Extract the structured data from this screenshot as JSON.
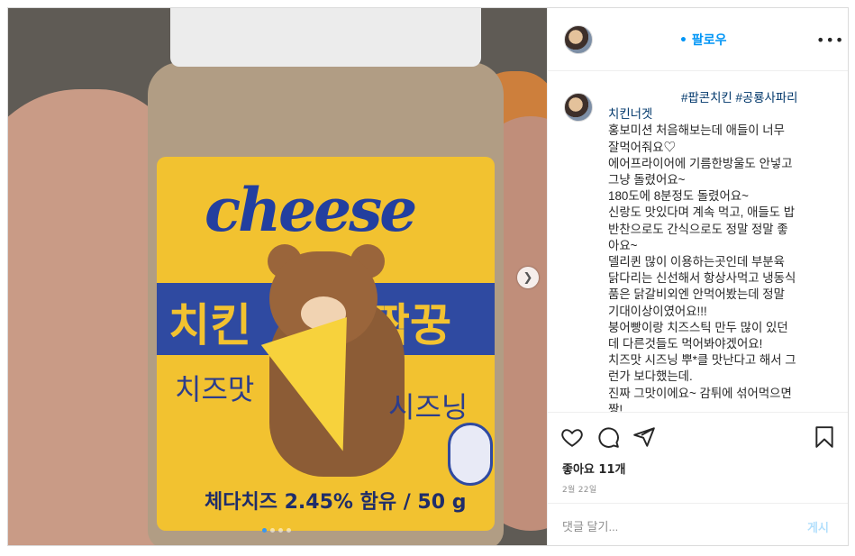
{
  "photo": {
    "label_cheese": "cheese",
    "label_chicken": "치킨",
    "label_jjakkkung": "짝꿍",
    "label_cheese_flavor": "치즈맛",
    "label_seasoning": "시즈닝",
    "label_ingredients": "체다치즈 2.45% 함유 / 50 g",
    "carousel_dot_count": 4,
    "active_dot_index": 0
  },
  "header": {
    "follow_label": "• 팔로우",
    "more_icon": "more-horizontal-icon"
  },
  "caption": {
    "hashtags": "#팝콘치킨 #공룡사파리",
    "lines": [
      "치킨너겟",
      "홍보미션 처음해보는데 애들이 너무",
      "잘먹어줘요♡",
      "에어프라이어에 기름한방울도 안넣고",
      "그냥 돌렸어요~",
      "180도에 8분정도 돌렸어요~",
      "신랑도 맛있다며 계속 먹고, 애들도 밥",
      "반찬으로도 간식으로도 정말 정말 좋",
      "아요~",
      "델리퀸 많이 이용하는곳인데 부분육",
      "닭다리는 신선해서 항상사먹고 냉동식",
      "품은 닭갈비외엔 안먹어봤는데 정말",
      "기대이상이였어요!!!",
      "붕어빵이랑 치즈스틱 만두 많이 있던",
      "데 다른것들도 먹어봐야겠어요!",
      "치즈맛 시즈닝 뿌*클 맛난다고 해서 그",
      "런가 보다했는데.",
      "진짜 그맛이에요~ 감튀에 섞어먹으면",
      "짱!"
    ]
  },
  "actions": {
    "likes": "좋아요 11개",
    "date": "2월 22일"
  },
  "comment": {
    "placeholder": "댓글 달기...",
    "post_label": "게시"
  },
  "colors": {
    "link_blue": "#0095f6",
    "hashtag_blue": "#00376b",
    "label_yellow": "#f2c230",
    "label_blue": "#2f4aa1"
  }
}
